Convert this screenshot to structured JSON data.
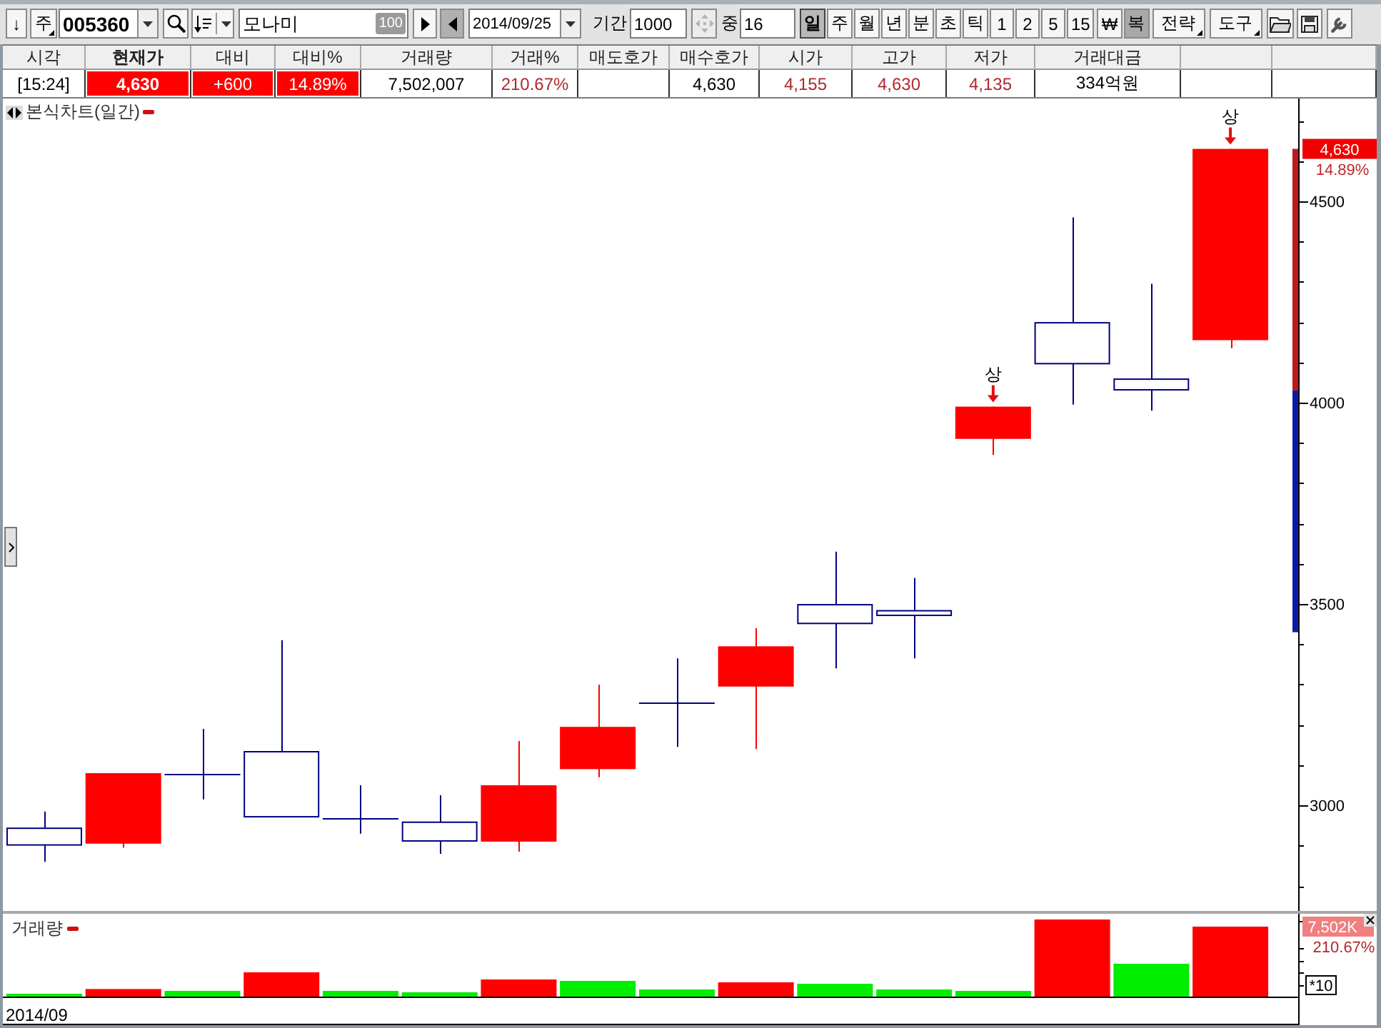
{
  "toolbar": {
    "down_button": "↓",
    "market_button": "주",
    "code_field": {
      "value": "005360"
    },
    "name_field": {
      "value": "모나미",
      "badge": "100"
    },
    "step_buttons": [
      {
        "kind": "forward",
        "pressed": false
      },
      {
        "kind": "back",
        "pressed": true
      }
    ],
    "date_field": {
      "value": "2014/09/25"
    },
    "period_label": "기간",
    "period_field": {
      "value": "1000"
    },
    "adjust_button": {
      "disabled": true
    },
    "count_label": "중",
    "count_field": {
      "value": "16"
    },
    "intervals": [
      {
        "label": "일",
        "selected": true
      },
      {
        "label": "주",
        "selected": false
      },
      {
        "label": "월",
        "selected": false
      },
      {
        "label": "년",
        "selected": false
      },
      {
        "label": "분",
        "selected": false
      },
      {
        "label": "초",
        "selected": false
      },
      {
        "label": "틱",
        "selected": false
      },
      {
        "label": "1",
        "selected": false
      },
      {
        "label": "2",
        "selected": false
      },
      {
        "label": "5",
        "selected": false
      },
      {
        "label": "15",
        "selected": false
      }
    ],
    "toggles": [
      {
        "label": "₩",
        "on": false
      },
      {
        "label": "복",
        "on": true
      }
    ],
    "menus": [
      "전략",
      "도구"
    ]
  },
  "quote_table": {
    "columns": [
      {
        "label": "시각",
        "bold": false
      },
      {
        "label": "현재가",
        "bold": true
      },
      {
        "label": "대비",
        "bold": false
      },
      {
        "label": "대비%",
        "bold": false
      },
      {
        "label": "거래량",
        "bold": false
      },
      {
        "label": "거래%",
        "bold": false
      },
      {
        "label": "매도호가",
        "bold": false
      },
      {
        "label": "매수호가",
        "bold": false
      },
      {
        "label": "시가",
        "bold": false
      },
      {
        "label": "고가",
        "bold": false
      },
      {
        "label": "저가",
        "bold": false
      },
      {
        "label": "거래대금",
        "bold": false
      }
    ],
    "row": [
      {
        "text": "[15:24]",
        "highlighted": false,
        "rising": false
      },
      {
        "text": "4,630",
        "highlighted": true,
        "rising": true
      },
      {
        "text": "+600",
        "highlighted": true,
        "rising": true
      },
      {
        "text": "14.89%",
        "highlighted": true,
        "rising": true
      },
      {
        "text": "7,502,007",
        "highlighted": false,
        "rising": false
      },
      {
        "text": "210.67%",
        "highlighted": false,
        "rising": true
      },
      {
        "highlighted": false
      },
      {
        "text": "4,630",
        "highlighted": false,
        "rising": false
      },
      {
        "text": "4,155",
        "highlighted": false,
        "rising": true
      },
      {
        "text": "4,630",
        "highlighted": false,
        "rising": true
      },
      {
        "text": "4,135",
        "highlighted": false,
        "rising": true
      },
      {
        "text": "334억원",
        "highlighted": false,
        "rising": false
      },
      {
        "highlighted": false
      },
      {
        "highlighted": false
      }
    ]
  },
  "price_chart": {
    "title": "본식차트(일간)",
    "axis_labels": [
      "4500",
      "4000",
      "3500",
      "3000"
    ],
    "limit_markers": [
      "상",
      "상"
    ],
    "price_tag": "4,630",
    "change_tag": "14.89%"
  },
  "volume_chart": {
    "title": "거래량",
    "value_tag": "7,502K",
    "ratio_tag": "210.67%",
    "scale_tag": "*10",
    "date_label": "2014/09"
  }
}
